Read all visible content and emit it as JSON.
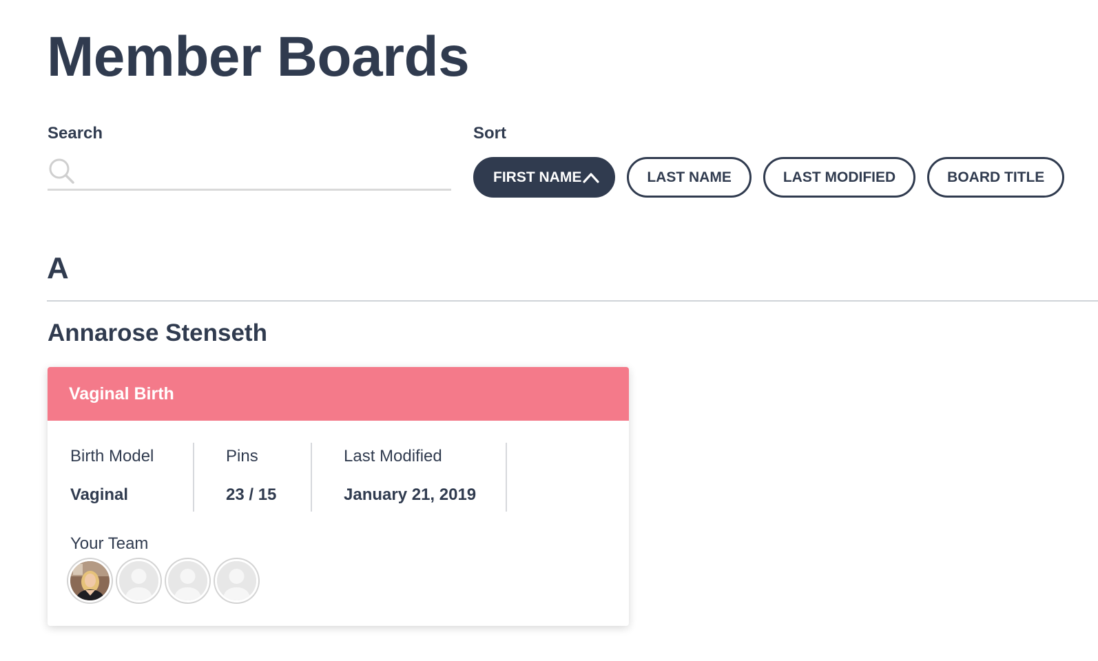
{
  "page": {
    "title": "Member Boards"
  },
  "search": {
    "label": "Search",
    "value": "",
    "placeholder": ""
  },
  "sort": {
    "label": "Sort",
    "options": [
      {
        "label": "FIRST NAME",
        "active": true,
        "direction": "ascending"
      },
      {
        "label": "LAST NAME",
        "active": false
      },
      {
        "label": "LAST MODIFIED",
        "active": false
      },
      {
        "label": "BOARD TITLE",
        "active": false
      }
    ]
  },
  "groups": [
    {
      "letter": "A",
      "members": [
        {
          "name": "Annarose Stenseth",
          "boards": [
            {
              "title": "Vaginal Birth",
              "header_color": "#f47a8a",
              "stats": [
                {
                  "label": "Birth Model",
                  "value": "Vaginal"
                },
                {
                  "label": "Pins",
                  "value": "23 / 15"
                },
                {
                  "label": "Last Modified",
                  "value": "January 21, 2019"
                }
              ],
              "team_label": "Your Team",
              "team": [
                {
                  "type": "photo",
                  "icon": "user-photo"
                },
                {
                  "type": "placeholder",
                  "icon": "default-user-icon"
                },
                {
                  "type": "placeholder",
                  "icon": "default-user-icon"
                },
                {
                  "type": "placeholder",
                  "icon": "default-user-icon"
                }
              ]
            }
          ]
        }
      ]
    }
  ],
  "colors": {
    "primary": "#303b4f",
    "board_header": "#f47a8a",
    "divider": "#cfd3d8"
  }
}
